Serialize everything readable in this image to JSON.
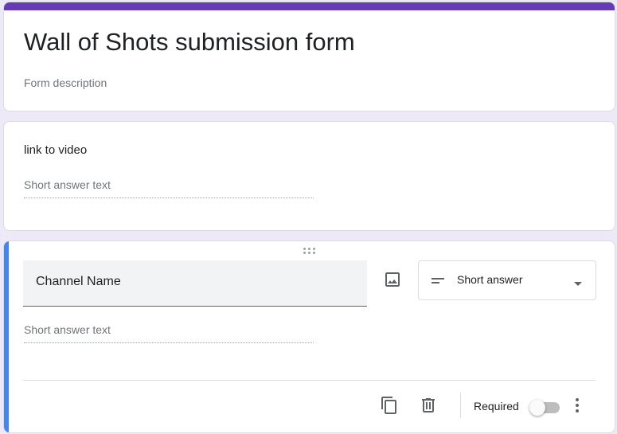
{
  "form": {
    "title": "Wall of Shots submission form",
    "description_placeholder": "Form description",
    "theme_color": "#673ab7"
  },
  "questions": [
    {
      "title": "link to video",
      "answer_placeholder": "Short answer text"
    },
    {
      "title": "Channel Name",
      "answer_placeholder": "Short answer text",
      "type_label": "Short answer",
      "required_label": "Required",
      "required": false,
      "active_color": "#4285f4",
      "icons": [
        "drag-handle-icon",
        "image-icon",
        "short-answer-icon",
        "dropdown-arrow-icon",
        "duplicate-icon",
        "trash-icon",
        "toggle-icon",
        "more-vert-icon"
      ]
    }
  ]
}
